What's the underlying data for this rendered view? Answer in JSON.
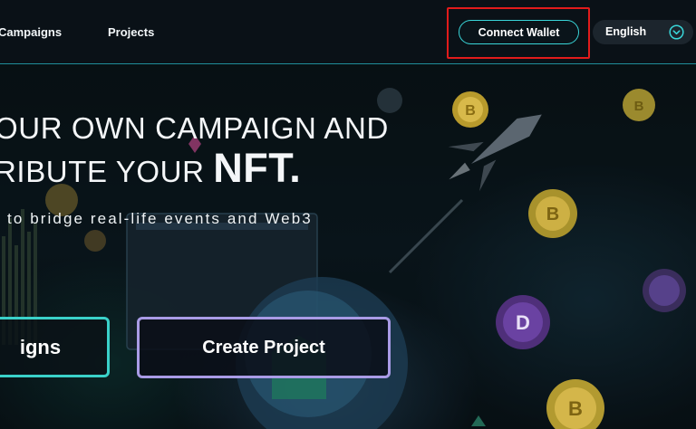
{
  "nav": {
    "links": [
      "Campaigns",
      "Projects"
    ],
    "connect_wallet": "Connect Wallet",
    "language": {
      "selected": "English",
      "icon": "chevron-down-icon"
    }
  },
  "hero": {
    "headline_line1": "OUR OWN CAMPAIGN AND",
    "headline_line2_prefix": "RIBUTE YOUR ",
    "headline_line2_emph": "NFT.",
    "subline": "to bridge real-life events and Web3",
    "buttons": {
      "campaigns": "igns",
      "create_project": "Create Project"
    }
  },
  "colors": {
    "accent_teal": "#39d6d9",
    "accent_purple": "#a99be6",
    "highlight_red": "#e11b1b",
    "nav_bg": "#0a1117"
  }
}
